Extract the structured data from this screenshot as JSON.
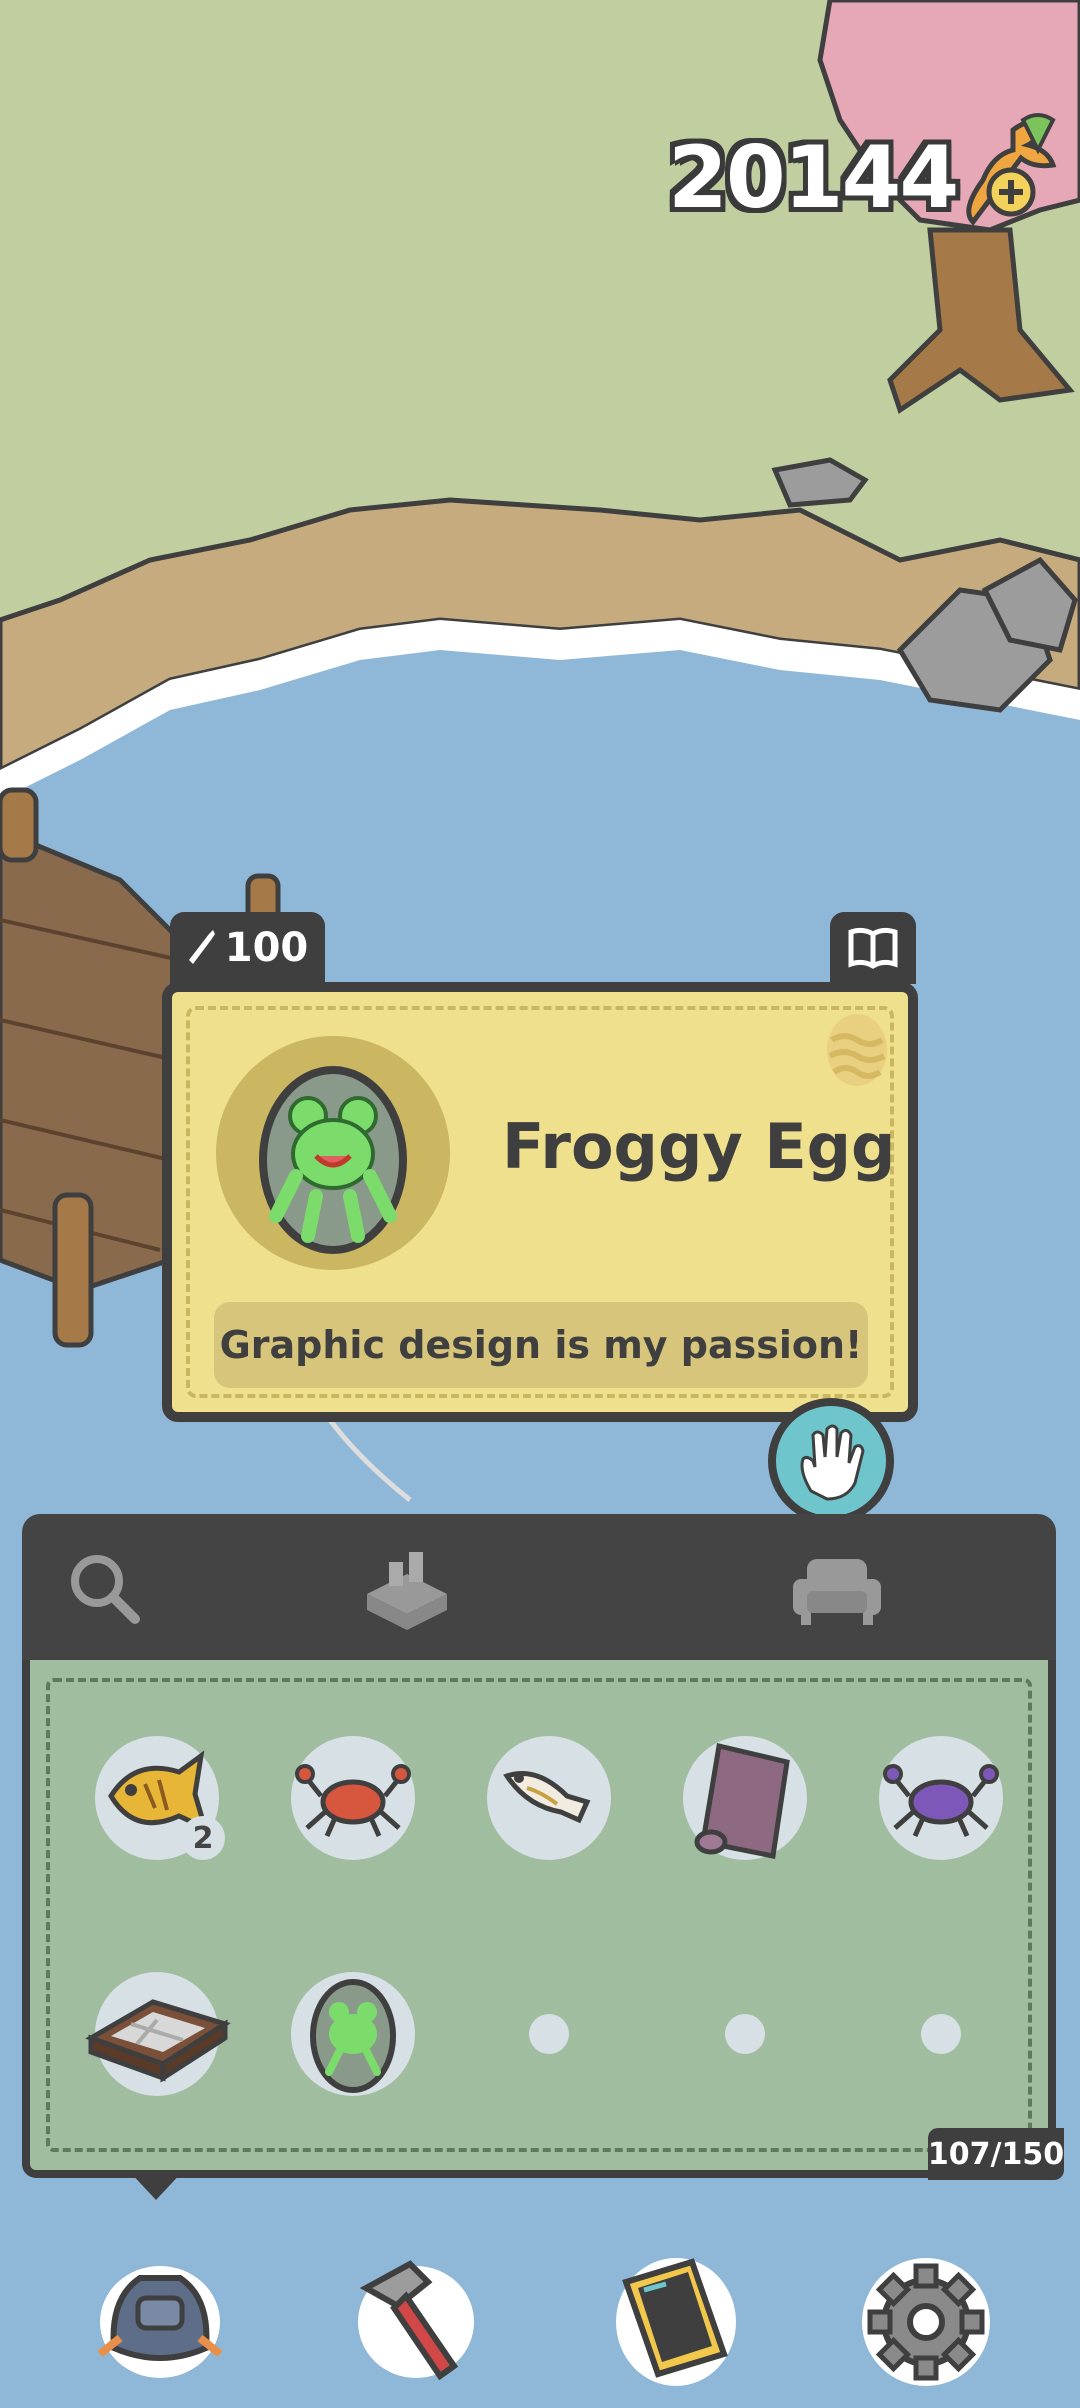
{
  "currency": {
    "value": "20144",
    "icon": "carrot-plus-icon"
  },
  "item_card": {
    "price": "100",
    "name": "Froggy Egg",
    "description": "Graphic design is my passion!"
  },
  "inventory": {
    "tabs": [
      "search-icon",
      "crafting-icon",
      "furniture-icon"
    ],
    "slots": [
      {
        "name": "yellow-fish",
        "count": "2"
      },
      {
        "name": "red-crab"
      },
      {
        "name": "white-fish"
      },
      {
        "name": "rolled-rug"
      },
      {
        "name": "purple-crab"
      },
      {
        "name": "window-tile"
      },
      {
        "name": "froggy-egg"
      }
    ],
    "capacity": "107/150"
  },
  "colors": {
    "water": "#8fb8d8",
    "grass": "#c1cfa0",
    "card": "#efe08d",
    "panel": "#a1bda0",
    "dark": "#3f3f3f"
  }
}
